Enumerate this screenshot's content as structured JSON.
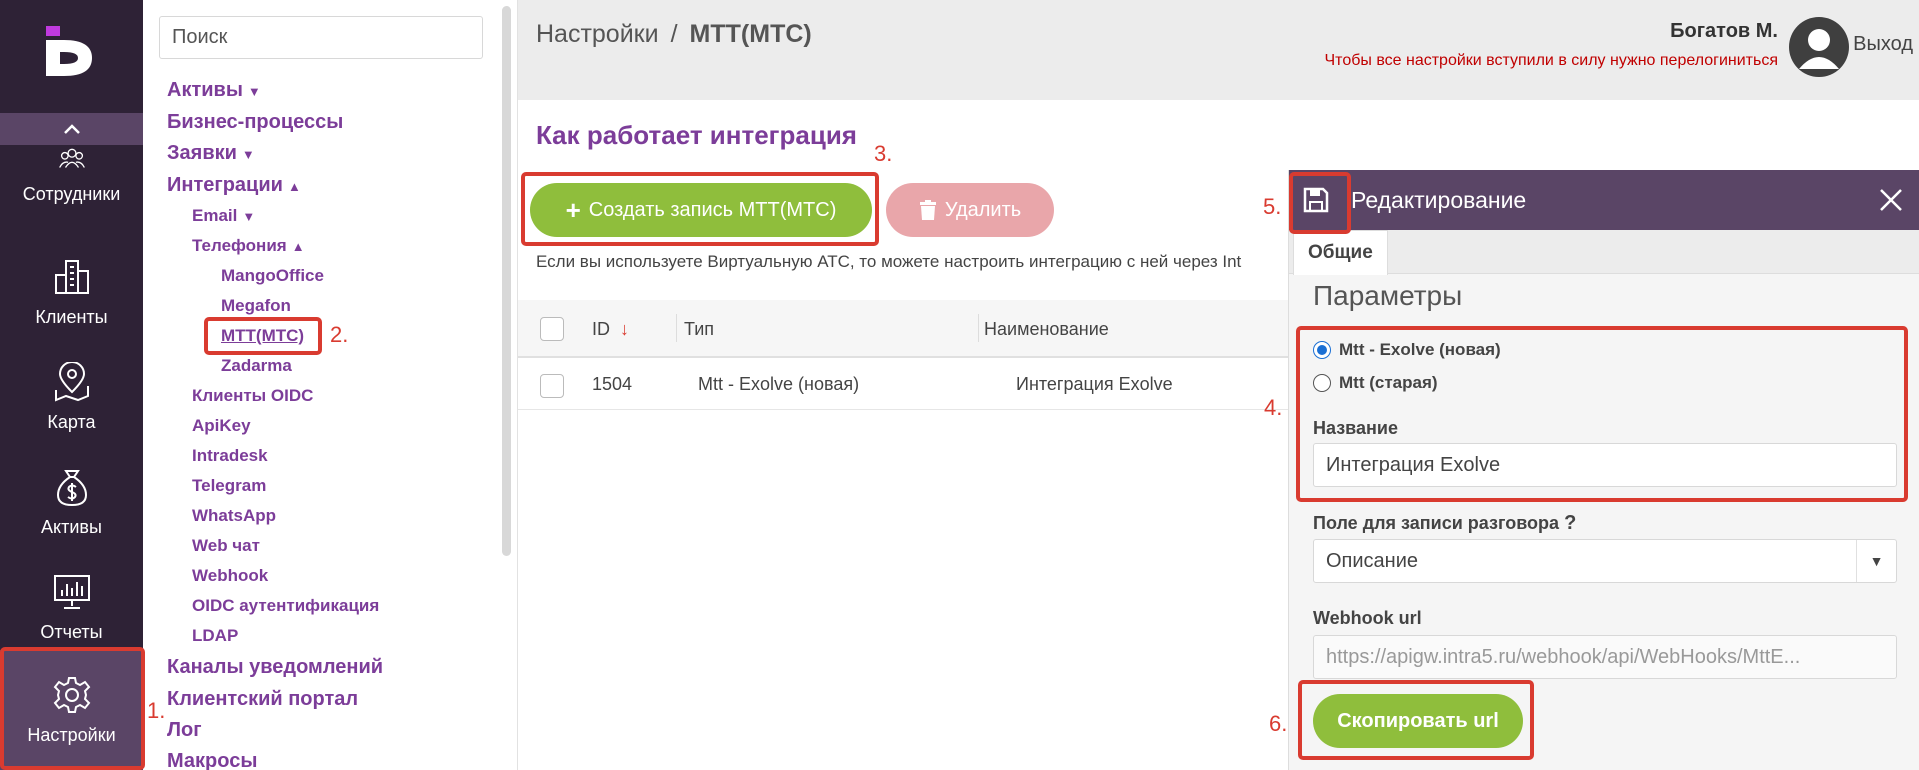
{
  "rail": {
    "items": [
      {
        "label": "Сотрудники",
        "icon": "users-icon"
      },
      {
        "label": "Клиенты",
        "icon": "buildings-icon"
      },
      {
        "label": "Карта",
        "icon": "map-pin-icon"
      },
      {
        "label": "Активы",
        "icon": "money-bag-icon"
      },
      {
        "label": "Отчеты",
        "icon": "monitor-chart-icon"
      },
      {
        "label": "Настройки",
        "icon": "gear-icon"
      }
    ]
  },
  "tree": {
    "search_placeholder": "Поиск",
    "aktivy": "Активы",
    "biz": "Бизнес-процессы",
    "zayavki": "Заявки",
    "integracii": "Интеграции",
    "email": "Email",
    "telefonia": "Телефония",
    "mango": "MangoOffice",
    "megafon": "Megafon",
    "mtt": "МТТ(МТС)",
    "zadarma": "Zadarma",
    "oidc_clients": "Клиенты OIDC",
    "apikey": "ApiKey",
    "intradesk": "Intradesk",
    "telegram": "Telegram",
    "whatsapp": "WhatsApp",
    "webchat": "Web чат",
    "webhook": "Webhook",
    "oidc_auth": "OIDC аутентификация",
    "ldap": "LDAP",
    "channels": "Каналы уведомлений",
    "portal": "Клиентский портал",
    "log": "Лог",
    "macros": "Макросы"
  },
  "header": {
    "crumb_root": "Настройки",
    "crumb_sep": "/",
    "crumb_current": "МТТ(МТС)",
    "user": "Богатов М.",
    "notice": "Чтобы все настройки вступили в силу нужно перелогиниться",
    "logout": "Выход"
  },
  "content": {
    "title": "Как работает интеграция",
    "create_btn": "Создать запись МТТ(МТС)",
    "delete_btn": "Удалить",
    "description": "Если вы используете Виртуальную АТС, то можете настроить интеграцию с ней через Int"
  },
  "table": {
    "headers": {
      "id": "ID",
      "type": "Тип",
      "name": "Наименование"
    },
    "rows": [
      {
        "id": "1504",
        "type": "Mtt - Exolve (новая)",
        "name": "Интеграция Exolve"
      }
    ]
  },
  "panel": {
    "title": "Редактирование",
    "tab": "Общие",
    "section": "Параметры",
    "radio_new": "Mtt - Exolve (новая)",
    "radio_old": "Mtt (старая)",
    "name_label": "Название",
    "name_value": "Интеграция Exolve",
    "record_label": "Поле для записи разговора",
    "record_help": "?",
    "record_value": "Описание",
    "webhook_label": "Webhook url",
    "webhook_value": "https://apigw.intra5.ru/webhook/api/WebHooks/MttE...",
    "copy_btn": "Скопировать url"
  },
  "annotations": [
    "1.",
    "2.",
    "3.",
    "4.",
    "5.",
    "6."
  ],
  "colors": {
    "accent": "#7c3d99",
    "rail": "#2e2236",
    "rail_active": "#5a4566",
    "green": "#8fbe3c",
    "danger": "#e9a6aa",
    "annotation": "#d93b30",
    "notice": "#c00000"
  }
}
